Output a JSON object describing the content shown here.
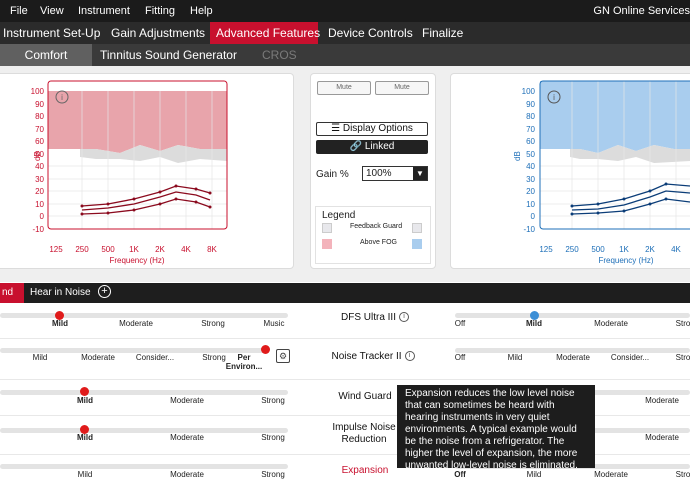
{
  "menu": {
    "items": [
      "File",
      "View",
      "Instrument",
      "Fitting",
      "Help"
    ],
    "brand": "GN Online Services"
  },
  "main_tabs": [
    "Instrument Set-Up",
    "Gain Adjustments",
    "Advanced Features",
    "Device Controls",
    "Finalize"
  ],
  "sub_tabs": [
    "Comfort",
    "Tinnitus Sound Generator",
    "CROS"
  ],
  "graph": {
    "dB_label": "dB",
    "y_ticks": [
      "100",
      "90",
      "80",
      "70",
      "60",
      "50",
      "40",
      "30",
      "20",
      "10",
      "0",
      "-10"
    ],
    "x_ticks": [
      "125",
      "250",
      "500",
      "1K",
      "2K",
      "4K",
      "8K"
    ],
    "xlabel": "Frequency (Hz)"
  },
  "center": {
    "mute_left": "Mute",
    "mute_right": "Mute",
    "display_options": "Display Options",
    "linked": "Linked",
    "gain_label": "Gain %",
    "gain_value": "100%",
    "legend_title": "Legend",
    "legend_feedback": "Feedback Guard",
    "legend_fog": "Above FOG"
  },
  "bottom_tabs": {
    "partial": "nd",
    "hear_in_noise": "Hear in Noise",
    "add": "+"
  },
  "features": {
    "dfs": "DFS Ultra III",
    "noise_tracker": "Noise Tracker II",
    "wind_guard": "Wind Guard",
    "impulse_line1": "Impulse Noise",
    "impulse_line2": "Reduction",
    "expansion": "Expansion"
  },
  "rows": {
    "dfs_left": [
      "Mild",
      "Moderate",
      "Strong",
      "Music"
    ],
    "dfs_right": [
      "Off",
      "Mild",
      "Moderate",
      "Stro"
    ],
    "nt_left": [
      "Mild",
      "Moderate",
      "Consider...",
      "Strong",
      "Per",
      "Environ..."
    ],
    "nt_right": [
      "Off",
      "Mild",
      "Moderate",
      "Consider...",
      "Stro"
    ],
    "wg_left": [
      "Mild",
      "Moderate",
      "Strong"
    ],
    "wg_right": [
      "Moderate",
      "Stro"
    ],
    "in_left": [
      "Mild",
      "Moderate",
      "Strong"
    ],
    "in_right": [
      "Moderate",
      "Stro"
    ],
    "ex_left": [
      "Mild",
      "Moderate",
      "Strong"
    ],
    "ex_right": [
      "Off",
      "Mild",
      "Moderate",
      "Stro"
    ]
  },
  "tooltip": "Expansion reduces the low level noise that can sometimes be heard with hearing instruments in very quiet environments. A typical example would be the noise from a refrigerator. The higher the level of expansion, the more unwanted low-level noise is eliminated.",
  "colors": {
    "accent_red": "#c8102e",
    "right_blue": "#1e6fb8"
  }
}
